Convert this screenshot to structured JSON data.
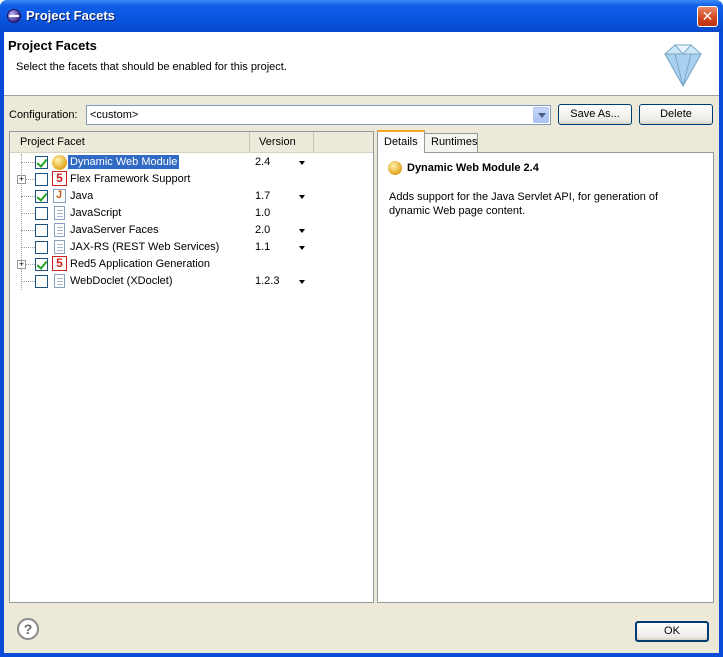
{
  "window": {
    "title": "Project Facets",
    "close_label": "✕"
  },
  "header": {
    "title": "Project Facets",
    "description": "Select the facets that should be enabled for this project."
  },
  "configuration": {
    "label": "Configuration:",
    "value": "<custom>",
    "save_as_label": "Save As...",
    "delete_label": "Delete"
  },
  "facets_table": {
    "columns": [
      "Project Facet",
      "Version"
    ],
    "rows": [
      {
        "name": "Dynamic Web Module",
        "version": "2.4",
        "checked": true,
        "icon": "web-module-icon",
        "has_dropdown": true,
        "expandable": false,
        "selected": true
      },
      {
        "name": "Flex Framework Support",
        "version": "",
        "checked": false,
        "icon": "five-badge-icon",
        "has_dropdown": false,
        "expandable": true,
        "selected": false
      },
      {
        "name": "Java",
        "version": "1.7",
        "checked": true,
        "icon": "java-icon",
        "has_dropdown": true,
        "expandable": false,
        "selected": false
      },
      {
        "name": "JavaScript",
        "version": "1.0",
        "checked": false,
        "icon": "document-icon",
        "has_dropdown": false,
        "expandable": false,
        "selected": false
      },
      {
        "name": "JavaServer Faces",
        "version": "2.0",
        "checked": false,
        "icon": "document-icon",
        "has_dropdown": true,
        "expandable": false,
        "selected": false
      },
      {
        "name": "JAX-RS (REST Web Services)",
        "version": "1.1",
        "checked": false,
        "icon": "document-icon",
        "has_dropdown": true,
        "expandable": false,
        "selected": false
      },
      {
        "name": "Red5 Application Generation",
        "version": "",
        "checked": true,
        "icon": "five-badge-icon",
        "has_dropdown": false,
        "expandable": true,
        "selected": false
      },
      {
        "name": "WebDoclet (XDoclet)",
        "version": "1.2.3",
        "checked": false,
        "icon": "document-icon",
        "has_dropdown": true,
        "expandable": false,
        "selected": false
      }
    ]
  },
  "details_panel": {
    "tabs": [
      "Details",
      "Runtimes"
    ],
    "active_tab": "Details",
    "title": "Dynamic Web Module 2.4",
    "description": "Adds support for the Java Servlet API, for generation of dynamic Web page content."
  },
  "footer": {
    "ok_label": "OK",
    "help_label": "?"
  },
  "colors": {
    "titlebar": "#0a55e0",
    "dialog_bg": "#ece9d8",
    "selection": "#316ac5"
  }
}
